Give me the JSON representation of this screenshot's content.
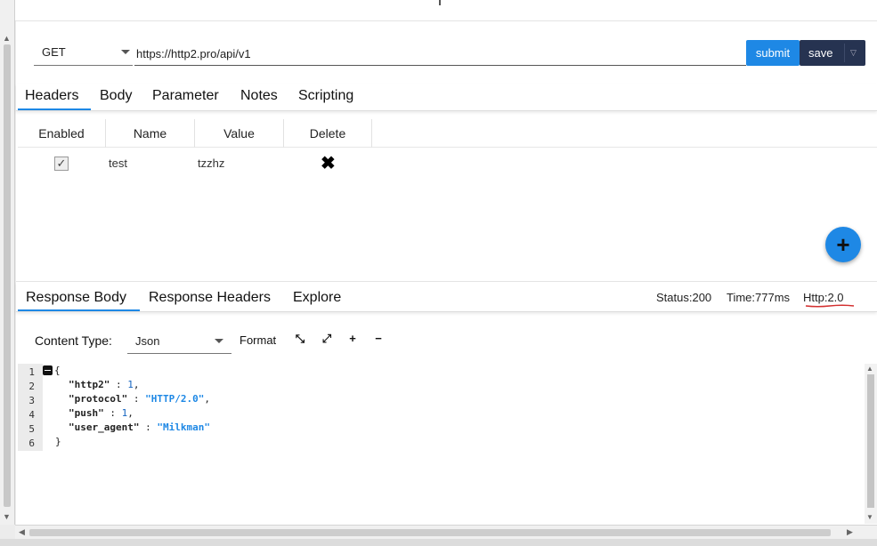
{
  "request": {
    "method": "GET",
    "url": "https://http2.pro/api/v1",
    "submit_label": "submit",
    "save_label": "save"
  },
  "request_tabs": [
    "Headers",
    "Body",
    "Parameter",
    "Notes",
    "Scripting"
  ],
  "headers_table": {
    "columns": [
      "Enabled",
      "Name",
      "Value",
      "Delete"
    ],
    "rows": [
      {
        "enabled": true,
        "name": "test",
        "value": "tzzhz"
      }
    ]
  },
  "add_button_icon": "plus-icon",
  "response_tabs": [
    "Response Body",
    "Response Headers",
    "Explore"
  ],
  "response_meta": {
    "status": "Status:200",
    "time": "Time:777ms",
    "http": "Http:2.0",
    "http_underline_color": "#d32f2f"
  },
  "response_toolbar": {
    "content_type_label": "Content Type:",
    "content_type_value": "Json",
    "format_label": "Format"
  },
  "response_code": {
    "line_numbers": [
      "1",
      "2",
      "3",
      "4",
      "5",
      "6"
    ],
    "open_brace": "{",
    "close_brace": "}",
    "entries": [
      {
        "key": "\"http2\"",
        "value": "1",
        "kind": "num"
      },
      {
        "key": "\"protocol\"",
        "value": "\"HTTP/2.0\"",
        "kind": "str"
      },
      {
        "key": "\"push\"",
        "value": "1",
        "kind": "num"
      },
      {
        "key": "\"user_agent\"",
        "value": "\"Milkman\"",
        "kind": "str"
      }
    ]
  },
  "colors": {
    "accent": "#1e88e5",
    "save_button": "#263351"
  }
}
